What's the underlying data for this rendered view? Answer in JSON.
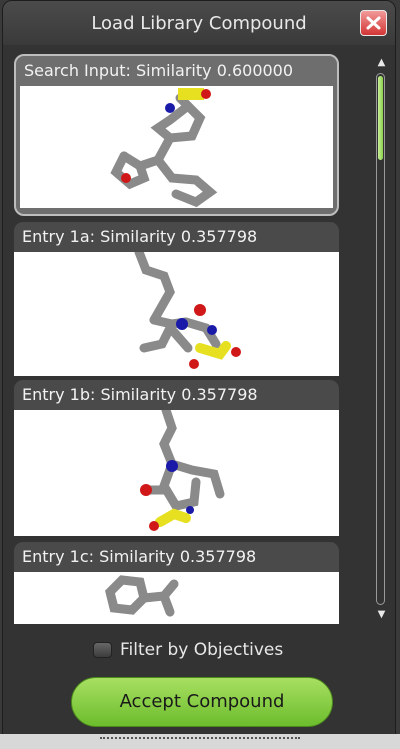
{
  "window": {
    "title": "Load Library Compound"
  },
  "entries": [
    {
      "label": "Search Input: Similarity 0.600000",
      "selected": true
    },
    {
      "label": "Entry 1a: Similarity 0.357798",
      "selected": false
    },
    {
      "label": "Entry 1b: Similarity 0.357798",
      "selected": false
    },
    {
      "label": "Entry 1c: Similarity 0.357798",
      "selected": false
    }
  ],
  "filter": {
    "label": "Filter by Objectives",
    "checked": false
  },
  "accept_button": {
    "label": "Accept Compound"
  },
  "colors": {
    "accent_green": "#8cd24c",
    "close_red": "#d43535",
    "atom_carbon": "#8a8a8a",
    "atom_nitrogen": "#1a1aa8",
    "atom_oxygen": "#d01818",
    "atom_sulfur": "#e6e020"
  },
  "icons": {
    "close": "close-x-icon",
    "scroll_up": "triangle-up-icon",
    "scroll_down": "triangle-down-icon"
  }
}
